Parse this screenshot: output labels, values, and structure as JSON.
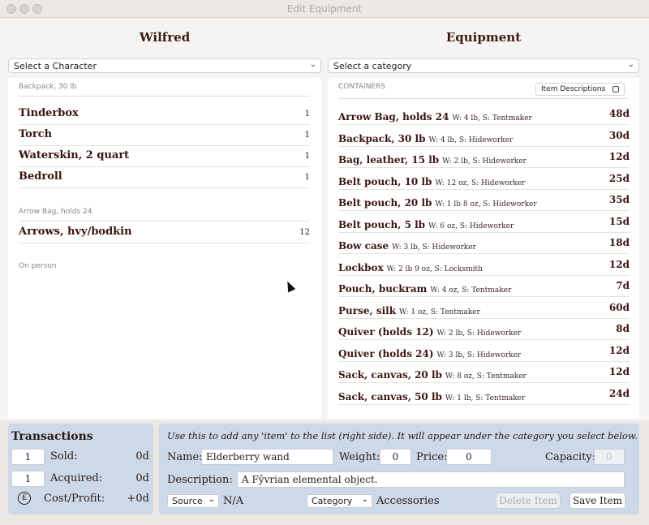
{
  "window": {
    "title": "Edit Equipment"
  },
  "character": {
    "name": "Wilfred",
    "select_label": "Select a Character",
    "groups": [
      {
        "label": "Backpack, 30 lb",
        "items": [
          {
            "name": "Tinderbox",
            "qty": "1"
          },
          {
            "name": "Torch",
            "qty": "1"
          },
          {
            "name": "Waterskin, 2 quart",
            "qty": "1"
          },
          {
            "name": "Bedroll",
            "qty": "1"
          }
        ]
      },
      {
        "label": "Arrow Bag, holds 24",
        "items": [
          {
            "name": "Arrows, hvy/bodkin",
            "qty": "12"
          }
        ]
      },
      {
        "label": "On person",
        "items": []
      }
    ]
  },
  "equipment": {
    "title": "Equipment",
    "select_label": "Select a category",
    "category_label": "CONTAINERS",
    "descriptions_toggle": "Item Descriptions",
    "items": [
      {
        "name": "Arrow Bag, holds 24",
        "meta": "W: 4 lb, S: Tentmaker",
        "price": "48d"
      },
      {
        "name": "Backpack, 30 lb",
        "meta": "W: 4 lb, S: Hideworker",
        "price": "30d"
      },
      {
        "name": "Bag, leather, 15 lb",
        "meta": "W: 2 lb, S: Hideworker",
        "price": "12d"
      },
      {
        "name": "Belt pouch, 10 lb",
        "meta": "W: 12 oz, S: Hideworker",
        "price": "25d"
      },
      {
        "name": "Belt pouch, 20 lb",
        "meta": "W: 1 lb 8 oz, S: Hideworker",
        "price": "35d"
      },
      {
        "name": "Belt pouch, 5 lb",
        "meta": "W: 6 oz, S: Hideworker",
        "price": "15d"
      },
      {
        "name": "Bow case",
        "meta": "W: 3 lb, S: Hideworker",
        "price": "18d"
      },
      {
        "name": "Lockbox",
        "meta": "W: 2 lb 9 oz, S: Locksmith",
        "price": "12d"
      },
      {
        "name": "Pouch, buckram",
        "meta": "W: 4 oz, S: Tentmaker",
        "price": "7d"
      },
      {
        "name": "Purse, silk",
        "meta": "W: 1 oz, S: Tentmaker",
        "price": "60d"
      },
      {
        "name": "Quiver (holds 12)",
        "meta": "W: 2 lb, S: Hideworker",
        "price": "8d"
      },
      {
        "name": "Quiver (holds 24)",
        "meta": "W: 3 lb, S: Hideworker",
        "price": "12d"
      },
      {
        "name": "Sack, canvas, 20 lb",
        "meta": "W: 8 oz, S: Tentmaker",
        "price": "12d"
      },
      {
        "name": "Sack, canvas, 50 lb",
        "meta": "W: 1 lb, S: Tentmaker",
        "price": "24d"
      }
    ]
  },
  "transactions": {
    "title": "Transactions",
    "sold_qty": "1",
    "sold_label": "Sold:",
    "sold_value": "0d",
    "acquired_qty": "1",
    "acquired_label": "Acquired:",
    "acquired_value": "0d",
    "cost_label": "Cost/Profit:",
    "cost_value": "+0d",
    "icon": "pound-coin-icon"
  },
  "editor": {
    "hint": "Use this to add any 'item' to the list (right side). It will appear under the category you select below.",
    "name_label": "Name:",
    "name_value": "Elderberry wand",
    "weight_label": "Weight:",
    "weight_value": "0",
    "price_label": "Price:",
    "price_value": "0",
    "capacity_label": "Capacity:",
    "capacity_value": "0",
    "description_label": "Description:",
    "description_value": "A Fŷvrian elemental object.",
    "source_select": "Source",
    "source_value": "N/A",
    "category_select": "Category",
    "category_value": "Accessories",
    "delete_label": "Delete Item",
    "save_label": "Save Item"
  }
}
